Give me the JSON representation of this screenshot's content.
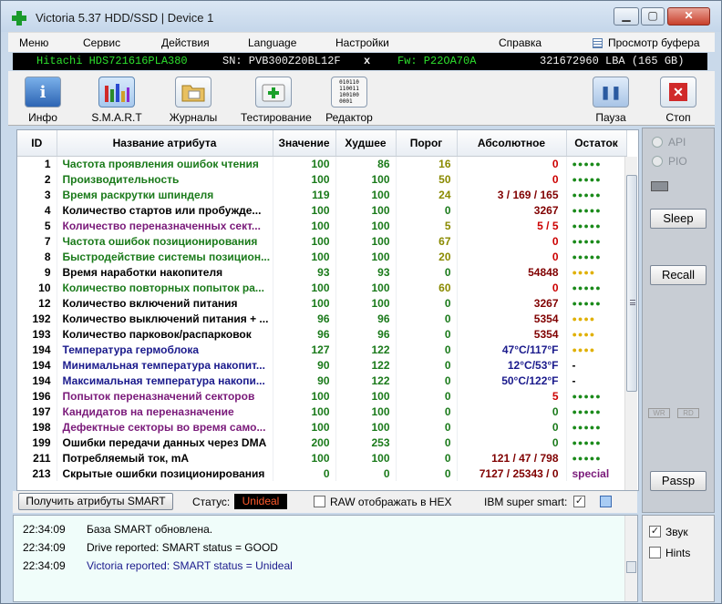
{
  "window": {
    "title": "Victoria 5.37 HDD/SSD | Device 1"
  },
  "menu": [
    "Меню",
    "Сервис",
    "Действия",
    "Language",
    "Настройки",
    "Справка"
  ],
  "buffer_view": "Просмотр буфера",
  "device": {
    "model": "Hitachi HDS721616PLA380",
    "serial": "SN: PVB300Z20BL12F",
    "x": "x",
    "firmware": "Fw: P22OA70A",
    "capacity": "321672960 LBA (165 GB)"
  },
  "toolbar": {
    "info": "Инфо",
    "smart": "S.M.A.R.T",
    "logs": "Журналы",
    "test": "Тестирование",
    "editor": "Редактор",
    "editor_icon_text": "010110\n110011\n100100\n0001",
    "pause": "Пауза",
    "stop": "Стоп"
  },
  "colors": {
    "green": "#1a7a1a",
    "purple": "#7a1a7a",
    "blue": "#1a1a8c",
    "black": "#000000",
    "darkred": "#800000",
    "olive": "#8a8a00",
    "red": "#cc0000",
    "dots_green": "#1a8a1a",
    "dots_yellow": "#e0b000"
  },
  "table": {
    "headers": [
      "ID",
      "Название атрибута",
      "Значение",
      "Худшее",
      "Порог",
      "Абсолютное",
      "Остаток"
    ],
    "rows": [
      {
        "id": "1",
        "name": "Частота проявления ошибок чтения",
        "name_color": "green",
        "value": "100",
        "worst": "86",
        "thr": "16",
        "thr_color": "olive",
        "raw": "0",
        "raw_color": "red",
        "health": "●●●●●",
        "health_color": "dots_green"
      },
      {
        "id": "2",
        "name": "Производительность",
        "name_color": "green",
        "value": "100",
        "worst": "100",
        "thr": "50",
        "thr_color": "olive",
        "raw": "0",
        "raw_color": "red",
        "health": "●●●●●",
        "health_color": "dots_green"
      },
      {
        "id": "3",
        "name": "Время раскрутки шпинделя",
        "name_color": "green",
        "value": "119",
        "worst": "100",
        "thr": "24",
        "thr_color": "olive",
        "raw": "3 / 169 / 165",
        "raw_color": "darkred",
        "health": "●●●●●",
        "health_color": "dots_green"
      },
      {
        "id": "4",
        "name": "Количество стартов или пробужде...",
        "name_color": "black",
        "value": "100",
        "worst": "100",
        "thr": "0",
        "thr_color": "green",
        "raw": "3267",
        "raw_color": "darkred",
        "health": "●●●●●",
        "health_color": "dots_green"
      },
      {
        "id": "5",
        "name": "Количество переназначенных сект...",
        "name_color": "purple",
        "value": "100",
        "worst": "100",
        "thr": "5",
        "thr_color": "olive",
        "raw": "5 / 5",
        "raw_color": "red",
        "health": "●●●●●",
        "health_color": "dots_green"
      },
      {
        "id": "7",
        "name": "Частота ошибок позиционирования",
        "name_color": "green",
        "value": "100",
        "worst": "100",
        "thr": "67",
        "thr_color": "olive",
        "raw": "0",
        "raw_color": "red",
        "health": "●●●●●",
        "health_color": "dots_green"
      },
      {
        "id": "8",
        "name": "Быстродействие системы позицион...",
        "name_color": "green",
        "value": "100",
        "worst": "100",
        "thr": "20",
        "thr_color": "olive",
        "raw": "0",
        "raw_color": "red",
        "health": "●●●●●",
        "health_color": "dots_green"
      },
      {
        "id": "9",
        "name": "Время наработки накопителя",
        "name_color": "black",
        "value": "93",
        "worst": "93",
        "thr": "0",
        "thr_color": "green",
        "raw": "54848",
        "raw_color": "darkred",
        "health": "●●●●",
        "health_color": "dots_yellow"
      },
      {
        "id": "10",
        "name": "Количество повторных попыток ра...",
        "name_color": "green",
        "value": "100",
        "worst": "100",
        "thr": "60",
        "thr_color": "olive",
        "raw": "0",
        "raw_color": "red",
        "health": "●●●●●",
        "health_color": "dots_green"
      },
      {
        "id": "12",
        "name": "Количество включений питания",
        "name_color": "black",
        "value": "100",
        "worst": "100",
        "thr": "0",
        "thr_color": "green",
        "raw": "3267",
        "raw_color": "darkred",
        "health": "●●●●●",
        "health_color": "dots_green"
      },
      {
        "id": "192",
        "name": "Количество выключений питания + ...",
        "name_color": "black",
        "value": "96",
        "worst": "96",
        "thr": "0",
        "thr_color": "green",
        "raw": "5354",
        "raw_color": "darkred",
        "health": "●●●●",
        "health_color": "dots_yellow"
      },
      {
        "id": "193",
        "name": "Количество парковок/распарковок",
        "name_color": "black",
        "value": "96",
        "worst": "96",
        "thr": "0",
        "thr_color": "green",
        "raw": "5354",
        "raw_color": "darkred",
        "health": "●●●●",
        "health_color": "dots_yellow"
      },
      {
        "id": "194",
        "name": "Температура гермоблока",
        "name_color": "blue",
        "value": "127",
        "worst": "122",
        "thr": "0",
        "thr_color": "green",
        "raw": "47°C/117°F",
        "raw_color": "blue",
        "health": "●●●●",
        "health_color": "dots_yellow"
      },
      {
        "id": "194",
        "name": "Минимальная температура накопит...",
        "name_color": "blue",
        "value": "90",
        "worst": "122",
        "thr": "0",
        "thr_color": "green",
        "raw": "12°C/53°F",
        "raw_color": "blue",
        "health": "-",
        "health_color": "black"
      },
      {
        "id": "194",
        "name": "Максимальная температура накопи...",
        "name_color": "blue",
        "value": "90",
        "worst": "122",
        "thr": "0",
        "thr_color": "green",
        "raw": "50°C/122°F",
        "raw_color": "blue",
        "health": "-",
        "health_color": "black"
      },
      {
        "id": "196",
        "name": "Попыток переназначений секторов",
        "name_color": "purple",
        "value": "100",
        "worst": "100",
        "thr": "0",
        "thr_color": "green",
        "raw": "5",
        "raw_color": "red",
        "health": "●●●●●",
        "health_color": "dots_green"
      },
      {
        "id": "197",
        "name": "Кандидатов на переназначение",
        "name_color": "purple",
        "value": "100",
        "worst": "100",
        "thr": "0",
        "thr_color": "green",
        "raw": "0",
        "raw_color": "green",
        "health": "●●●●●",
        "health_color": "dots_green"
      },
      {
        "id": "198",
        "name": "Дефектные секторы во время само...",
        "name_color": "purple",
        "value": "100",
        "worst": "100",
        "thr": "0",
        "thr_color": "green",
        "raw": "0",
        "raw_color": "green",
        "health": "●●●●●",
        "health_color": "dots_green"
      },
      {
        "id": "199",
        "name": "Ошибки передачи данных через DMA",
        "name_color": "black",
        "value": "200",
        "worst": "253",
        "thr": "0",
        "thr_color": "green",
        "raw": "0",
        "raw_color": "green",
        "health": "●●●●●",
        "health_color": "dots_green"
      },
      {
        "id": "211",
        "name": "Потребляемый ток, mA",
        "name_color": "black",
        "value": "100",
        "worst": "100",
        "thr": "0",
        "thr_color": "green",
        "raw": "121 / 47 / 798",
        "raw_color": "darkred",
        "health": "●●●●●",
        "health_color": "dots_green"
      },
      {
        "id": "213",
        "name": "Скрытые ошибки позиционирования",
        "name_color": "black",
        "value": "0",
        "worst": "0",
        "thr": "0",
        "thr_color": "green",
        "raw": "7127 / 25343 / 0",
        "raw_color": "darkred",
        "health": "special",
        "health_color": "purple"
      }
    ]
  },
  "status_bar": {
    "get_button": "Получить атрибуты SMART",
    "status_label": "Статус:",
    "status_value": "Unideal",
    "raw_hex": "RAW отображать в HEX",
    "ibm": "IBM super smart:",
    "ibm_check": "✓"
  },
  "log": [
    {
      "time": "22:34:09",
      "text": "База SMART обновлена.",
      "color": "#000000"
    },
    {
      "time": "22:34:09",
      "text": "Drive reported: SMART status = GOOD",
      "color": "#000000"
    },
    {
      "time": "22:34:09",
      "text": "Victoria reported: SMART status = Unideal",
      "color": "#1a1a8c"
    }
  ],
  "side": {
    "api": "API",
    "pio": "PIO",
    "sleep": "Sleep",
    "recall": "Recall",
    "passp": "Passp",
    "wr": "WR",
    "rd": "RD",
    "sound": "Звук",
    "sound_check": "✓",
    "hints": "Hints"
  }
}
